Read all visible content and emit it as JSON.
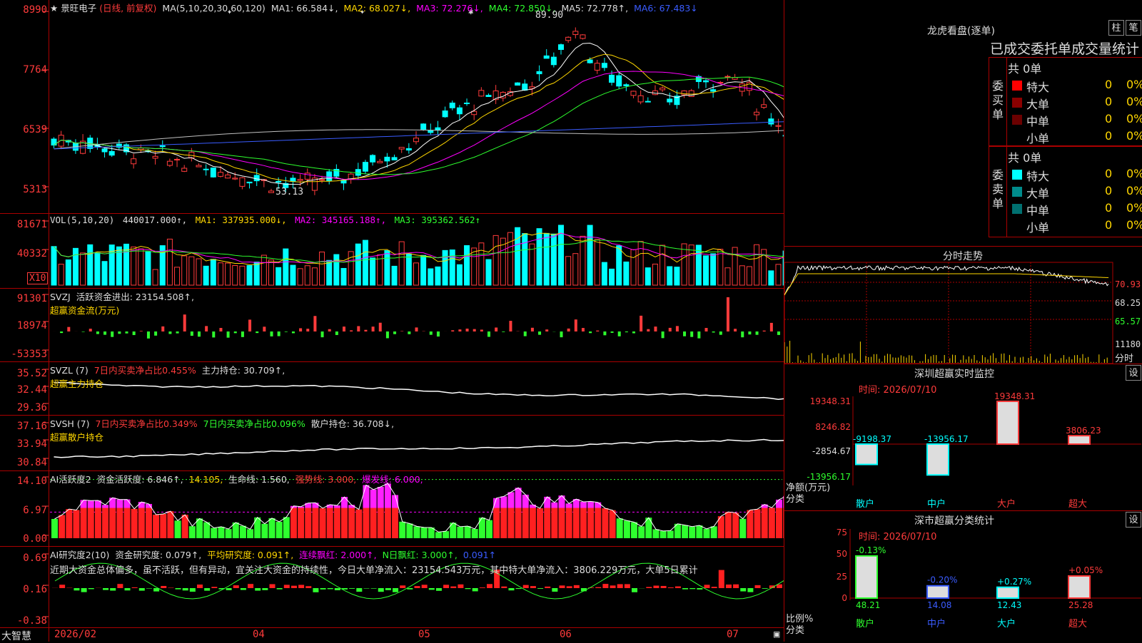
{
  "app": {
    "brand": "大智慧"
  },
  "kline": {
    "star": "★",
    "stock_name": "景旺电子",
    "mode": "(日线, 前复权)",
    "ma_params": "MA(5,10,20,30,60,120)",
    "ma1": "MA1: 66.584↓,",
    "ma2": "MA2: 68.027↓,",
    "ma3": "MA3: 72.276↓,",
    "ma4": "MA4: 72.850↓,",
    "ma5": "MA5: 72.778↑,",
    "ma6": "MA6: 67.483↓",
    "y_labels": [
      "8990",
      "7764",
      "6539",
      "5313"
    ],
    "high_label": "89.90",
    "low_label": "53.13"
  },
  "vol": {
    "title": "VOL(5,10,20)",
    "value": "440017.000↑,",
    "ma1": "MA1: 337935.000↓,",
    "ma2": "MA2: 345165.188↑,",
    "ma3": "MA3: 395362.562↑",
    "y_labels": [
      "81671",
      "40332"
    ],
    "unit": "X10"
  },
  "svzj": {
    "title": "SVZJ",
    "label": "活跃资金进出: 23154.508↑,",
    "sub": "超赢资金流(万元)",
    "y_labels": [
      "91301",
      "18974",
      "-53353"
    ]
  },
  "svzl": {
    "title": "SVZL (7)",
    "l1": "7日内买卖净占比0.455%",
    "l2": "主力持仓: 30.709↑,",
    "sub": "超赢主力持仓",
    "y_labels": [
      "35.52",
      "32.44",
      "29.36"
    ]
  },
  "svsh": {
    "title": "SVSH (7)",
    "l1": "7日内买卖净占比0.349%",
    "l2": "7日内买卖净占比0.096%",
    "l3": "散户持仓: 36.708↓,",
    "sub": "超赢散户持仓",
    "y_labels": [
      "37.16",
      "33.94",
      "30.84"
    ]
  },
  "ai1": {
    "title": "AI活跃度2",
    "l1": "资金活跃度: 6.846↑,",
    "l2": "14.105,",
    "l3": "生命线: 1.560,",
    "l4": "强势线: 3.000,",
    "l5": "爆发线: 6.000,",
    "y_labels": [
      "14.10",
      "6.97",
      "0.00"
    ]
  },
  "ai2": {
    "title": "AI研究度2(10)",
    "l1": "资金研究度: 0.079↑,",
    "l2": "平均研究度: 0.091↑,",
    "l3": "连续飘红: 2.000↑,",
    "l4": "N日飘红: 3.000↑,",
    "l5": "0.091↑",
    "comment": "近期大资金总体偏多，虽不活跃，但有异动，宜关注大资金的持续性，今日大单净流入：23154.543万元，其中特大单净流入：3806.229万元，大单5日累计",
    "y_labels": [
      "0.69",
      "0.16",
      "-0.38"
    ]
  },
  "xaxis": {
    "labels": [
      "2026/02",
      "04",
      "05",
      "06",
      "07"
    ]
  },
  "lhb": {
    "title": "龙虎看盘(逐单)",
    "btn1": "柱",
    "btn2": "笔",
    "header": "已成交委托单成交量统计",
    "buy_side": "委买单",
    "sell_side": "委卖单",
    "buy_total": "共 0单",
    "sell_total": "共 0单",
    "buy_rows": [
      {
        "name": "特大",
        "count": "0",
        "pct": "0%",
        "color": "#ff0000"
      },
      {
        "name": "大单",
        "count": "0",
        "pct": "0%",
        "color": "#8b0000"
      },
      {
        "name": "中单",
        "count": "0",
        "pct": "0%",
        "color": "#6b0000"
      },
      {
        "name": "小单",
        "count": "0",
        "pct": "0%",
        "color": "#000000"
      }
    ],
    "sell_rows": [
      {
        "name": "特大",
        "count": "0",
        "pct": "0%",
        "color": "#00ffff"
      },
      {
        "name": "大单",
        "count": "0",
        "pct": "0%",
        "color": "#008b8b"
      },
      {
        "name": "中单",
        "count": "0",
        "pct": "0%",
        "color": "#007070"
      },
      {
        "name": "小单",
        "count": "0",
        "pct": "0%",
        "color": "#000000"
      }
    ]
  },
  "fenshi": {
    "title": "分时走势",
    "y_labels": [
      "70.93",
      "68.25",
      "65.57"
    ],
    "vol_label": "11180",
    "sub": "分时"
  },
  "sz_monitor": {
    "title": "深圳超赢实时监控",
    "btn": "设",
    "date": "时间: 2026/07/10",
    "y_labels": [
      "19348.31",
      "8246.82",
      "-2854.67",
      "-13956.17"
    ],
    "unit": "净额(万元)",
    "cat_label": "分类",
    "categories": [
      "散户",
      "中户",
      "大户",
      "超大"
    ],
    "values": [
      -9198.37,
      -13956.17,
      19348.31,
      3806.23
    ],
    "value_labels": [
      "-9198.37",
      "-13956.17",
      "19348.31",
      "3806.23"
    ]
  },
  "sz_class": {
    "title": "深市超赢分类统计",
    "btn": "设",
    "date": "时间: 2026/07/10",
    "y_labels": [
      "75",
      "50",
      "25",
      "0"
    ],
    "unit": "比例%",
    "cat_label": "分类",
    "categories": [
      "散户",
      "中户",
      "大户",
      "超大"
    ],
    "change_labels": [
      "-0.13%",
      "-0.20%",
      "+0.27%",
      "+0.05%"
    ],
    "values": [
      48.21,
      14.08,
      12.43,
      25.28
    ],
    "value_labels": [
      "48.21",
      "14.08",
      "12.43",
      "25.28"
    ]
  },
  "chart_data": [
    {
      "type": "candlestick",
      "title": "景旺电子 (日线, 前复权)",
      "ylim": [
        50,
        92
      ],
      "annotations": [
        "89.90",
        "53.13"
      ],
      "series": [
        {
          "name": "MA1",
          "last": 66.584
        },
        {
          "name": "MA2",
          "last": 68.027
        },
        {
          "name": "MA3",
          "last": 72.276
        },
        {
          "name": "MA4",
          "last": 72.85
        },
        {
          "name": "MA5",
          "last": 72.778
        },
        {
          "name": "MA6",
          "last": 67.483
        }
      ]
    },
    {
      "type": "bar",
      "title": "VOL(5,10,20)",
      "last": 440017.0
    },
    {
      "type": "bar",
      "title": "深圳超赢实时监控",
      "categories": [
        "散户",
        "中户",
        "大户",
        "超大"
      ],
      "values": [
        -9198.37,
        -13956.17,
        19348.31,
        3806.23
      ],
      "ylabel": "净额(万元)"
    },
    {
      "type": "bar",
      "title": "深市超赢分类统计",
      "categories": [
        "散户",
        "中户",
        "大户",
        "超大"
      ],
      "values": [
        48.21,
        14.08,
        12.43,
        25.28
      ],
      "ylabel": "比例%",
      "ylim": [
        0,
        75
      ]
    }
  ]
}
